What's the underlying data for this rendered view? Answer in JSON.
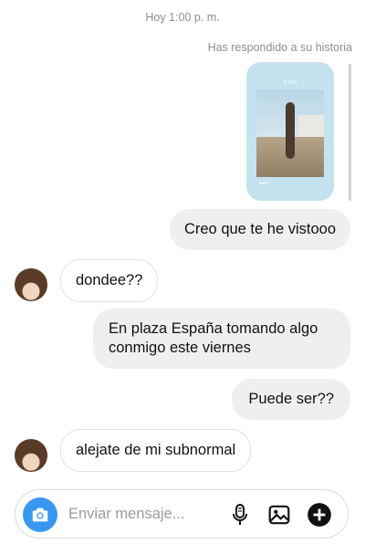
{
  "timestamp": "Hoy 1:00 p. m.",
  "replied_to_story": "Has respondido a su historia",
  "story": {
    "top_label": "2 JUN",
    "bottom_label": "●●●"
  },
  "messages": [
    {
      "from": "me",
      "text": "Creo que te he vistooo"
    },
    {
      "from": "them",
      "text": "dondee??"
    },
    {
      "from": "me",
      "text": "En plaza España tomando algo\nconmigo este viernes"
    },
    {
      "from": "me",
      "text": "Puede ser??"
    },
    {
      "from": "them",
      "text": "alejate de mi subnormal"
    }
  ],
  "composer": {
    "placeholder": "Enviar mensaje...",
    "value": "",
    "camera_icon": "camera-icon",
    "mic_icon": "microphone-icon",
    "gallery_icon": "image-icon",
    "more_icon": "plus-circle-icon"
  },
  "colors": {
    "camera_button": "#3897f0",
    "sent_bubble": "#efefef",
    "received_border": "#e2e2e2",
    "meta_text": "#8e8e8e",
    "story_card": "#c5e3ee"
  }
}
